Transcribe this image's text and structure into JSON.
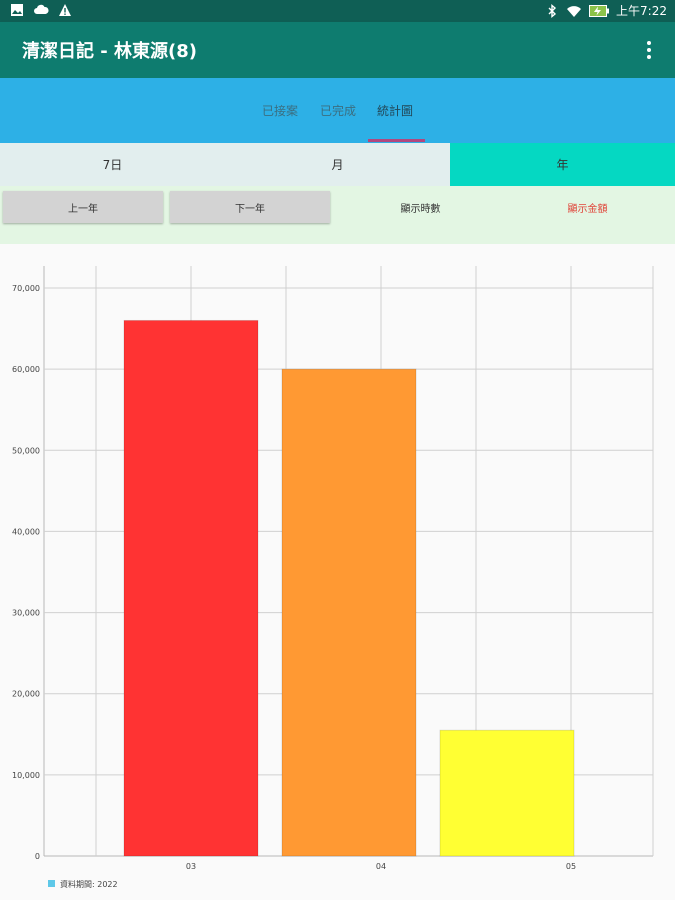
{
  "status_bar": {
    "left_icons": [
      "image-icon",
      "cloud-icon",
      "warning-icon"
    ],
    "right_icons": [
      "bluetooth-icon",
      "wifi-icon",
      "battery-charging-icon"
    ],
    "time": "上午7:22"
  },
  "app_bar": {
    "title": "清潔日記 - 林東源(8)",
    "menu_icon": "overflow-menu-icon"
  },
  "tabs": [
    {
      "label": "已接案",
      "active": false
    },
    {
      "label": "已完成",
      "active": false
    },
    {
      "label": "統計圖",
      "active": true
    }
  ],
  "period_segments": [
    {
      "label": "7日",
      "selected": false
    },
    {
      "label": "月",
      "selected": false
    },
    {
      "label": "年",
      "selected": true
    }
  ],
  "buttons": {
    "prev_year": "上一年",
    "next_year": "下一年",
    "show_count": "顯示時數",
    "show_amount": "顯示金額"
  },
  "colors": {
    "status_bar": "#0f5f55",
    "app_bar": "#0e7c6f",
    "tab_bar": "#2db0e6",
    "segment_selected": "#05d8c2",
    "button_row_bg": "#e3f6e3",
    "show_amount_text": "#e0453a"
  },
  "chart_data": {
    "type": "bar",
    "categories": [
      "03",
      "04",
      "05"
    ],
    "values": [
      66000,
      60000,
      15500
    ],
    "colors": [
      "#ff3333",
      "#ff9933",
      "#ffff33"
    ],
    "ylim": [
      0,
      70000
    ],
    "yticks": [
      "0",
      "10,000",
      "20,000",
      "30,000",
      "40,000",
      "50,000",
      "60,000",
      "70,000"
    ],
    "grid": true,
    "legend": {
      "label": "資料期間: 2022",
      "color": "#5ec8e8",
      "position": "bottom-left"
    }
  }
}
